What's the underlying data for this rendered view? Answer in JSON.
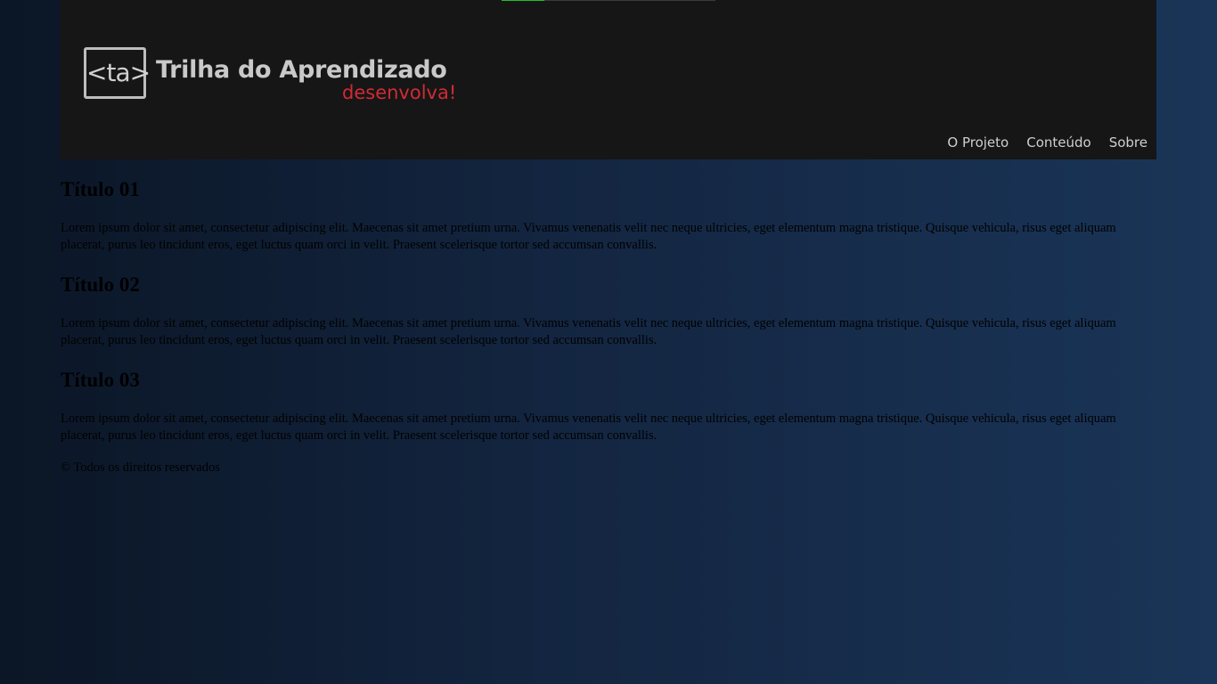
{
  "progress": {
    "value": 0.2,
    "fill_color": "#22c12a",
    "track_color": "#3a3a3a"
  },
  "logo": {
    "mark": "<ta>",
    "title": "Trilha do Aprendizado",
    "tagline": "desenvolva!",
    "tagline_color": "#d02b35"
  },
  "nav": {
    "items": [
      "O Projeto",
      "Conteúdo",
      "Sobre"
    ]
  },
  "sections": [
    {
      "title": "Título 01",
      "text": "Lorem ipsum dolor sit amet, consectetur adipiscing elit. Maecenas sit amet pretium urna. Vivamus venenatis velit nec neque ultricies, eget elementum magna tristique. Quisque vehicula, risus eget aliquam placerat, purus leo tincidunt eros, eget luctus quam orci in velit. Praesent scelerisque tortor sed accumsan convallis."
    },
    {
      "title": "Título 02",
      "text": "Lorem ipsum dolor sit amet, consectetur adipiscing elit. Maecenas sit amet pretium urna. Vivamus venenatis velit nec neque ultricies, eget elementum magna tristique. Quisque vehicula, risus eget aliquam placerat, purus leo tincidunt eros, eget luctus quam orci in velit. Praesent scelerisque tortor sed accumsan convallis."
    },
    {
      "title": "Título 03",
      "text": "Lorem ipsum dolor sit amet, consectetur adipiscing elit. Maecenas sit amet pretium urna. Vivamus venenatis velit nec neque ultricies, eget elementum magna tristique. Quisque vehicula, risus eget aliquam placerat, purus leo tincidunt eros, eget luctus quam orci in velit. Praesent scelerisque tortor sed accumsan convallis."
    }
  ],
  "footer": {
    "copyright": "© Todos os direitos reservados"
  }
}
